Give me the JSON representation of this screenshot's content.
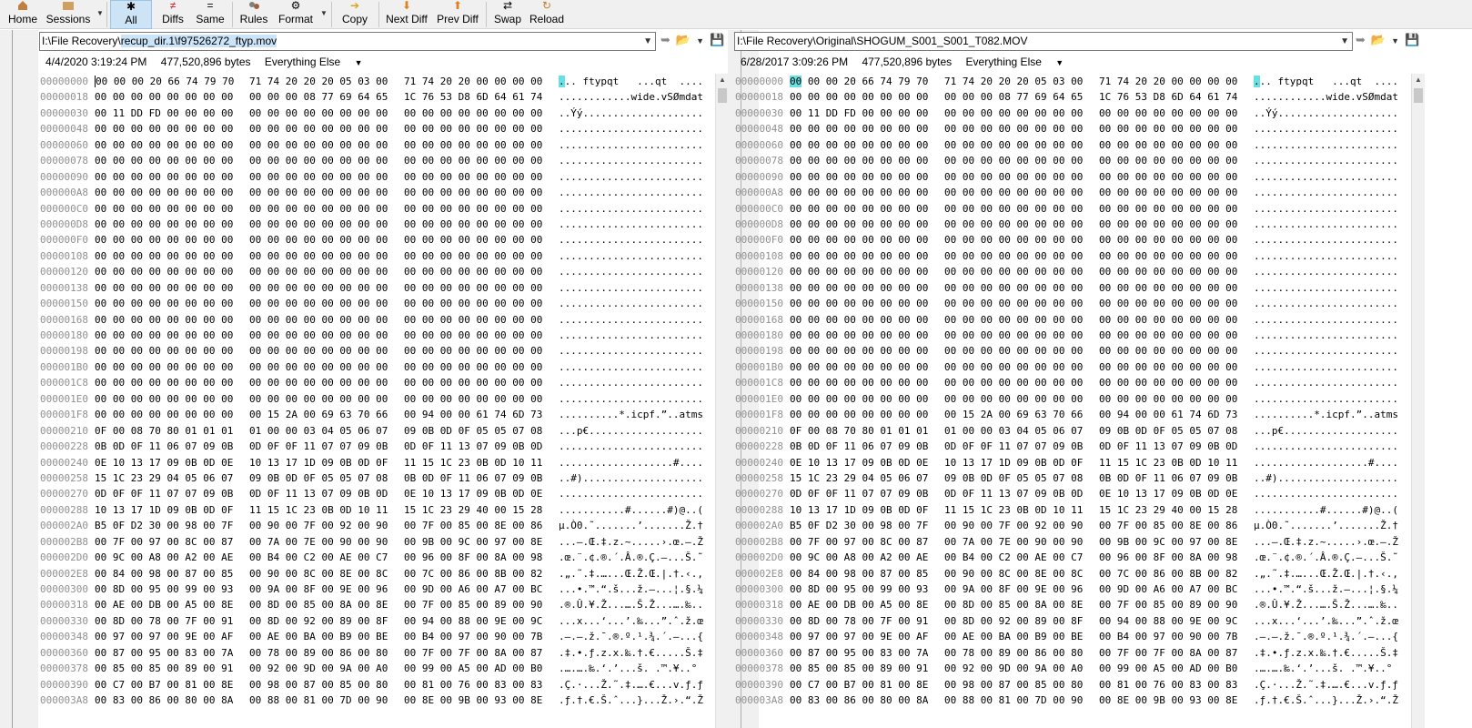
{
  "toolbar": {
    "home": "Home",
    "sessions": "Sessions",
    "all": "All",
    "diffs": "Diffs",
    "same": "Same",
    "rules": "Rules",
    "format": "Format",
    "copy": "Copy",
    "next_diff": "Next Diff",
    "prev_diff": "Prev Diff",
    "swap": "Swap",
    "reload": "Reload"
  },
  "left": {
    "path_prefix": "I:\\File Recovery\\",
    "path_selected": "recup_dir.1\\f97526272_ftyp.mov",
    "date": "4/4/2020 3:19:24 PM",
    "size": "477,520,896 bytes",
    "filter": "Everything Else"
  },
  "right": {
    "path": "I:\\File Recovery\\Original\\SHOGUM_S001_S001_T082.MOV",
    "date": "6/28/2017 3:09:26 PM",
    "size": "477,520,896 bytes",
    "filter": "Everything Else"
  },
  "colors": {
    "cursor_highlight": "#66e0e0",
    "selection": "#cce4f7",
    "offset_text": "#909090"
  },
  "rows": [
    {
      "off": "00000000",
      "h1": "00 00 00 20 66 74 79 70",
      "h2": "71 74 20 20 20 05 03 00",
      "h3": "71 74 20 20 00 00 00 00",
      "a": "... ftypqt   ...qt  ...."
    },
    {
      "off": "00000018",
      "h1": "00 00 00 00 00 00 00 00",
      "h2": "00 00 00 08 77 69 64 65",
      "h3": "1C 76 53 D8 6D 64 61 74",
      "a": "............wide.vSØmdat"
    },
    {
      "off": "00000030",
      "h1": "00 11 DD FD 00 00 00 00",
      "h2": "00 00 00 00 00 00 00 00",
      "h3": "00 00 00 00 00 00 00 00",
      "a": "..Ýý...................."
    },
    {
      "off": "00000048",
      "h1": "00 00 00 00 00 00 00 00",
      "h2": "00 00 00 00 00 00 00 00",
      "h3": "00 00 00 00 00 00 00 00",
      "a": "........................"
    },
    {
      "off": "00000060",
      "h1": "00 00 00 00 00 00 00 00",
      "h2": "00 00 00 00 00 00 00 00",
      "h3": "00 00 00 00 00 00 00 00",
      "a": "........................"
    },
    {
      "off": "00000078",
      "h1": "00 00 00 00 00 00 00 00",
      "h2": "00 00 00 00 00 00 00 00",
      "h3": "00 00 00 00 00 00 00 00",
      "a": "........................"
    },
    {
      "off": "00000090",
      "h1": "00 00 00 00 00 00 00 00",
      "h2": "00 00 00 00 00 00 00 00",
      "h3": "00 00 00 00 00 00 00 00",
      "a": "........................"
    },
    {
      "off": "000000A8",
      "h1": "00 00 00 00 00 00 00 00",
      "h2": "00 00 00 00 00 00 00 00",
      "h3": "00 00 00 00 00 00 00 00",
      "a": "........................"
    },
    {
      "off": "000000C0",
      "h1": "00 00 00 00 00 00 00 00",
      "h2": "00 00 00 00 00 00 00 00",
      "h3": "00 00 00 00 00 00 00 00",
      "a": "........................"
    },
    {
      "off": "000000D8",
      "h1": "00 00 00 00 00 00 00 00",
      "h2": "00 00 00 00 00 00 00 00",
      "h3": "00 00 00 00 00 00 00 00",
      "a": "........................"
    },
    {
      "off": "000000F0",
      "h1": "00 00 00 00 00 00 00 00",
      "h2": "00 00 00 00 00 00 00 00",
      "h3": "00 00 00 00 00 00 00 00",
      "a": "........................"
    },
    {
      "off": "00000108",
      "h1": "00 00 00 00 00 00 00 00",
      "h2": "00 00 00 00 00 00 00 00",
      "h3": "00 00 00 00 00 00 00 00",
      "a": "........................"
    },
    {
      "off": "00000120",
      "h1": "00 00 00 00 00 00 00 00",
      "h2": "00 00 00 00 00 00 00 00",
      "h3": "00 00 00 00 00 00 00 00",
      "a": "........................"
    },
    {
      "off": "00000138",
      "h1": "00 00 00 00 00 00 00 00",
      "h2": "00 00 00 00 00 00 00 00",
      "h3": "00 00 00 00 00 00 00 00",
      "a": "........................"
    },
    {
      "off": "00000150",
      "h1": "00 00 00 00 00 00 00 00",
      "h2": "00 00 00 00 00 00 00 00",
      "h3": "00 00 00 00 00 00 00 00",
      "a": "........................"
    },
    {
      "off": "00000168",
      "h1": "00 00 00 00 00 00 00 00",
      "h2": "00 00 00 00 00 00 00 00",
      "h3": "00 00 00 00 00 00 00 00",
      "a": "........................"
    },
    {
      "off": "00000180",
      "h1": "00 00 00 00 00 00 00 00",
      "h2": "00 00 00 00 00 00 00 00",
      "h3": "00 00 00 00 00 00 00 00",
      "a": "........................"
    },
    {
      "off": "00000198",
      "h1": "00 00 00 00 00 00 00 00",
      "h2": "00 00 00 00 00 00 00 00",
      "h3": "00 00 00 00 00 00 00 00",
      "a": "........................"
    },
    {
      "off": "000001B0",
      "h1": "00 00 00 00 00 00 00 00",
      "h2": "00 00 00 00 00 00 00 00",
      "h3": "00 00 00 00 00 00 00 00",
      "a": "........................"
    },
    {
      "off": "000001C8",
      "h1": "00 00 00 00 00 00 00 00",
      "h2": "00 00 00 00 00 00 00 00",
      "h3": "00 00 00 00 00 00 00 00",
      "a": "........................"
    },
    {
      "off": "000001E0",
      "h1": "00 00 00 00 00 00 00 00",
      "h2": "00 00 00 00 00 00 00 00",
      "h3": "00 00 00 00 00 00 00 00",
      "a": "........................"
    },
    {
      "off": "000001F8",
      "h1": "00 00 00 00 00 00 00 00",
      "h2": "00 15 2A 00 69 63 70 66",
      "h3": "00 94 00 00 61 74 6D 73",
      "a": "..........*.icpf.”..atms"
    },
    {
      "off": "00000210",
      "h1": "0F 00 08 70 80 01 01 01",
      "h2": "01 00 00 03 04 05 06 07",
      "h3": "09 0B 0D 0F 05 05 07 08",
      "a": "...p€..................."
    },
    {
      "off": "00000228",
      "h1": "0B 0D 0F 11 06 07 09 0B",
      "h2": "0D 0F 0F 11 07 07 09 0B",
      "h3": "0D 0F 11 13 07 09 0B 0D",
      "a": "........................"
    },
    {
      "off": "00000240",
      "h1": "0E 10 13 17 09 0B 0D 0E",
      "h2": "10 13 17 1D 09 0B 0D 0F",
      "h3": "11 15 1C 23 0B 0D 10 11",
      "a": "...................#...."
    },
    {
      "off": "00000258",
      "h1": "15 1C 23 29 04 05 06 07",
      "h2": "09 0B 0D 0F 05 05 07 08",
      "h3": "0B 0D 0F 11 06 07 09 0B",
      "a": "..#)...................."
    },
    {
      "off": "00000270",
      "h1": "0D 0F 0F 11 07 07 09 0B",
      "h2": "0D 0F 11 13 07 09 0B 0D",
      "h3": "0E 10 13 17 09 0B 0D 0E",
      "a": "........................"
    },
    {
      "off": "00000288",
      "h1": "10 13 17 1D 09 0B 0D 0F",
      "h2": "11 15 1C 23 0B 0D 10 11",
      "h3": "15 1C 23 29 40 00 15 28",
      "a": "...........#......#)@..("
    },
    {
      "off": "000002A0",
      "h1": "B5 0F D2 30 00 98 00 7F",
      "h2": "00 90 00 7F 00 92 00 90",
      "h3": "00 7F 00 85 00 8E 00 86",
      "a": "µ.Ò0.˜.......’.......Ž.†"
    },
    {
      "off": "000002B8",
      "h1": "00 7F 00 97 00 8C 00 87",
      "h2": "00 7A 00 7E 00 90 00 90",
      "h3": "00 9B 00 9C 00 97 00 8E",
      "a": "...–.Œ.‡.z.~.....›.œ.–.Ž"
    },
    {
      "off": "000002D0",
      "h1": "00 9C 00 A8 00 A2 00 AE",
      "h2": "00 B4 00 C2 00 AE 00 C7",
      "h3": "00 96 00 8F 00 8A 00 98",
      "a": ".œ.¨.¢.®.´.Â.®.Ç.–...Š.˜"
    },
    {
      "off": "000002E8",
      "h1": "00 84 00 98 00 87 00 85",
      "h2": "00 90 00 8C 00 8E 00 8C",
      "h3": "00 7C 00 86 00 8B 00 82",
      "a": ".„.˜.‡.…...Œ.Ž.Œ.|.†.‹.‚"
    },
    {
      "off": "00000300",
      "h1": "00 8D 00 95 00 99 00 93",
      "h2": "00 9A 00 8F 00 9E 00 96",
      "h3": "00 9D 00 A6 00 A7 00 BC",
      "a": "...•.™.“.š...ž.–...¦.§.¼"
    },
    {
      "off": "00000318",
      "h1": "00 AE 00 DB 00 A5 00 8E",
      "h2": "00 8D 00 85 00 8A 00 8E",
      "h3": "00 7F 00 85 00 89 00 90",
      "a": ".®.Û.¥.Ž...….Š.Ž...….‰.."
    },
    {
      "off": "00000330",
      "h1": "00 8D 00 78 00 7F 00 91",
      "h2": "00 8D 00 92 00 89 00 8F",
      "h3": "00 94 00 88 00 9E 00 9C",
      "a": "...x...‘...’.‰...”.ˆ.ž.œ"
    },
    {
      "off": "00000348",
      "h1": "00 97 00 97 00 9E 00 AF",
      "h2": "00 AE 00 BA 00 B9 00 BE",
      "h3": "00 B4 00 97 00 90 00 7B",
      "a": ".—.—.ž.¯.®.º.¹.¾.´.—...{"
    },
    {
      "off": "00000360",
      "h1": "00 87 00 95 00 83 00 7A",
      "h2": "00 78 00 89 00 86 00 80",
      "h3": "00 7F 00 7F 00 8A 00 87",
      "a": ".‡.•.ƒ.z.x.‰.†.€.....Š.‡"
    },
    {
      "off": "00000378",
      "h1": "00 85 00 85 00 89 00 91",
      "h2": "00 92 00 9D 00 9A 00 A0",
      "h3": "00 99 00 A5 00 AD 00 B0",
      "a": ".….….‰.‘.’...š. .™.¥.­.°"
    },
    {
      "off": "00000390",
      "h1": "00 C7 00 B7 00 81 00 8E",
      "h2": "00 98 00 87 00 85 00 80",
      "h3": "00 81 00 76 00 83 00 83",
      "a": ".Ç.·...Ž.˜.‡.….€...v.ƒ.ƒ"
    },
    {
      "off": "000003A8",
      "h1": "00 83 00 86 00 80 00 8A",
      "h2": "00 88 00 81 00 7D 00 90",
      "h3": "00 8E 00 9B 00 93 00 8E",
      "a": ".ƒ.†.€.Š.ˆ...}...Ž.›.“.Ž"
    }
  ]
}
